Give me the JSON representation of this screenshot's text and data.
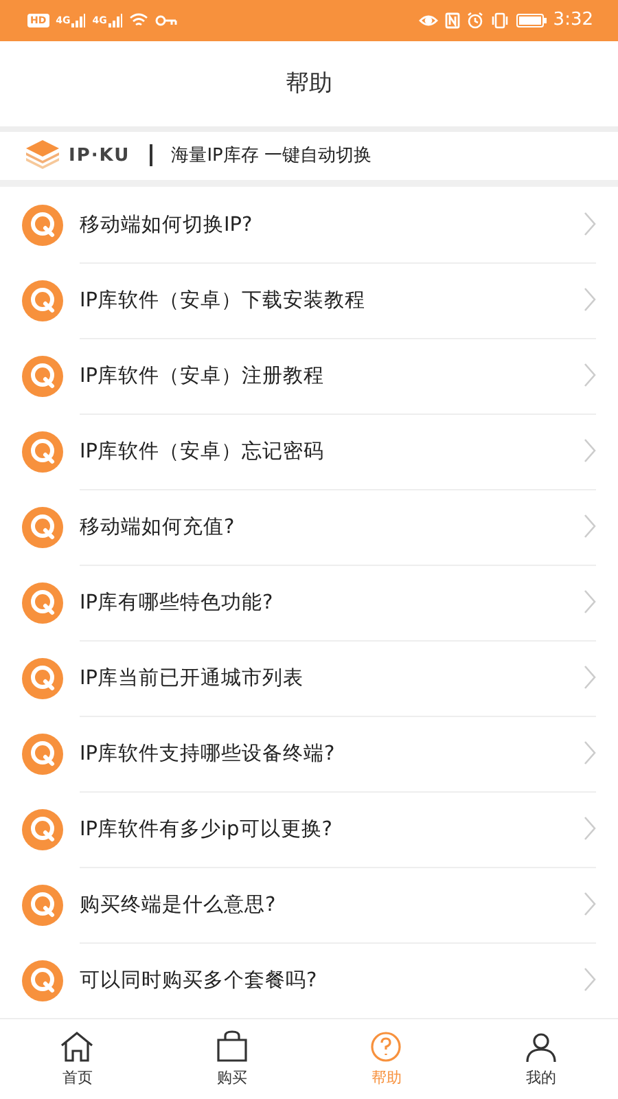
{
  "status_bar": {
    "hd": "HD",
    "networks": [
      "4G",
      "4G"
    ],
    "time": "3:32"
  },
  "header": {
    "title": "帮助"
  },
  "banner": {
    "logo_text": "IP·KU",
    "tagline": "海量IP库存 一键自动切换"
  },
  "questions": [
    {
      "text": "移动端如何切换IP?"
    },
    {
      "text": "IP库软件（安卓）下载安装教程"
    },
    {
      "text": "IP库软件（安卓）注册教程"
    },
    {
      "text": "IP库软件（安卓）忘记密码"
    },
    {
      "text": "移动端如何充值?"
    },
    {
      "text": "IP库有哪些特色功能?"
    },
    {
      "text": "IP库当前已开通城市列表"
    },
    {
      "text": "IP库软件支持哪些设备终端?"
    },
    {
      "text": "IP库软件有多少ip可以更换?"
    },
    {
      "text": "购买终端是什么意思?"
    },
    {
      "text": "可以同时购买多个套餐吗?"
    }
  ],
  "tab_bar": [
    {
      "label": "首页",
      "kind": "home",
      "selected": false
    },
    {
      "label": "购买",
      "kind": "bag",
      "selected": false
    },
    {
      "label": "帮助",
      "kind": "help",
      "selected": true
    },
    {
      "label": "我的",
      "kind": "user",
      "selected": false
    }
  ]
}
